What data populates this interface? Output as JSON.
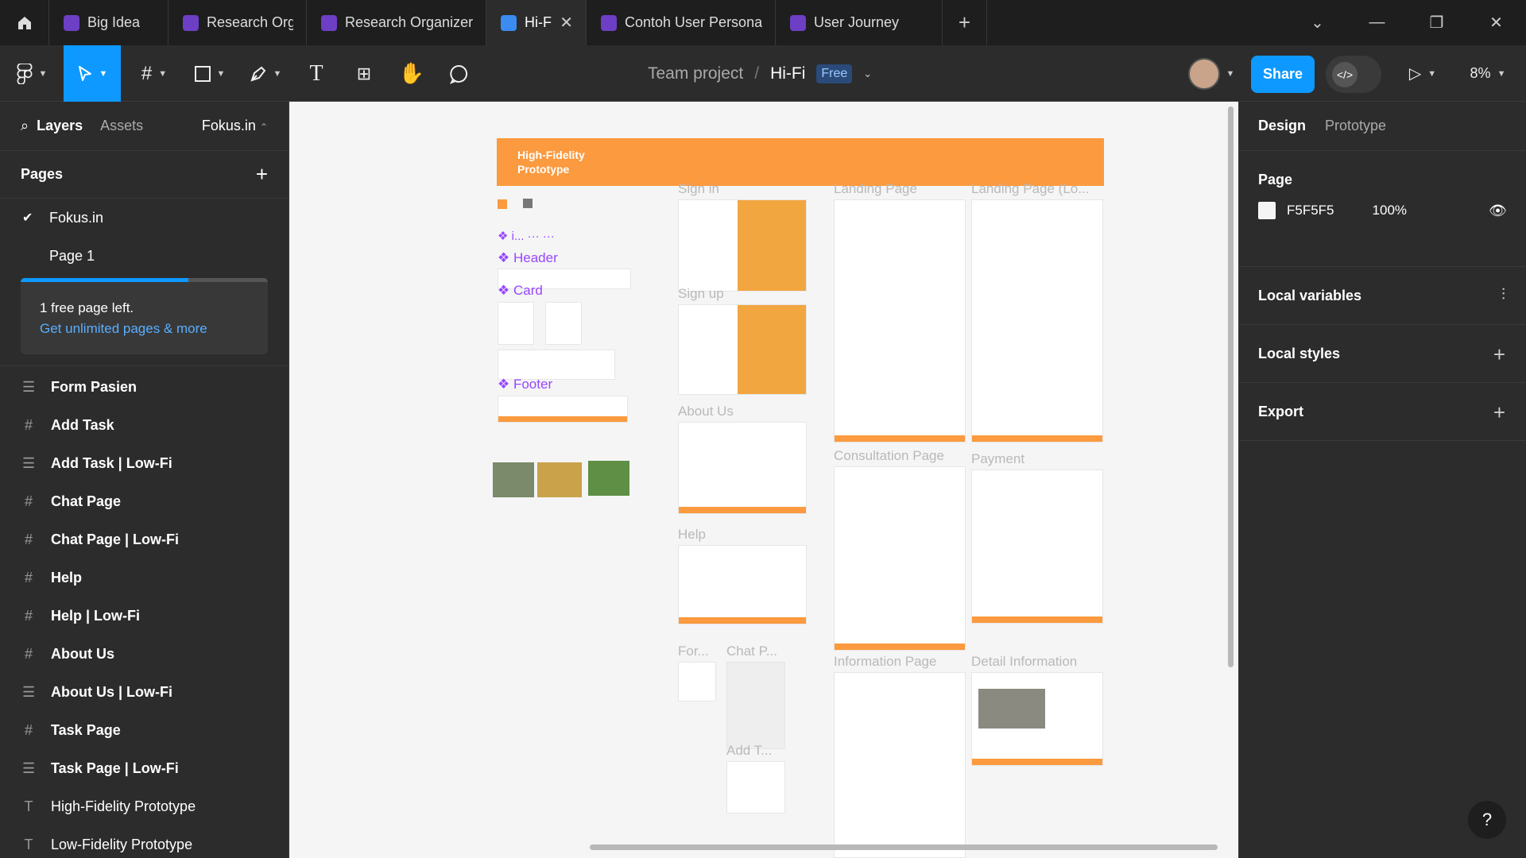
{
  "tabs": [
    {
      "label": "Big Idea"
    },
    {
      "label": "Research Organizer (C"
    },
    {
      "label": "Research Organizer (K"
    },
    {
      "label": "Hi-Fi",
      "active": true
    },
    {
      "label": "Contoh User Persona"
    },
    {
      "label": "User Journey"
    }
  ],
  "toolbar": {
    "project": "Team project",
    "separator": "/",
    "file": "Hi-Fi",
    "plan_badge": "Free",
    "share_label": "Share",
    "zoom": "8%"
  },
  "left": {
    "tab_layers": "Layers",
    "tab_assets": "Assets",
    "file_name": "Fokus.in",
    "pages_title": "Pages",
    "pages": [
      "Fokus.in",
      "Page 1"
    ],
    "promo_text": "1 free page left.",
    "promo_link": "Get unlimited pages & more",
    "layers": [
      {
        "label": "Form Pasien",
        "icon": "lines"
      },
      {
        "label": "Add Task",
        "icon": "hash"
      },
      {
        "label": "Add Task | Low-Fi",
        "icon": "lines"
      },
      {
        "label": "Chat Page",
        "icon": "hash"
      },
      {
        "label": "Chat Page | Low-Fi",
        "icon": "hash"
      },
      {
        "label": "Help",
        "icon": "hash"
      },
      {
        "label": "Help | Low-Fi",
        "icon": "hash"
      },
      {
        "label": "About Us",
        "icon": "hash"
      },
      {
        "label": "About Us | Low-Fi",
        "icon": "lines"
      },
      {
        "label": "Task Page",
        "icon": "hash"
      },
      {
        "label": "Task Page | Low-Fi",
        "icon": "lines"
      },
      {
        "label": "High-Fidelity Prototype",
        "icon": "text"
      },
      {
        "label": "Low-Fidelity Prototype",
        "icon": "text"
      }
    ]
  },
  "canvas": {
    "banner": "High-Fidelity Prototype",
    "components": {
      "header": "Header",
      "card": "Card",
      "footer": "Footer",
      "truncated": "i..."
    },
    "labels": {
      "sign_in": "Sign in",
      "sign_up": "Sign up",
      "about": "About Us",
      "help": "Help",
      "form": "For...",
      "chat": "Chat P...",
      "add": "Add T...",
      "landing": "Landing Page",
      "landing_lo": "Landing Page (Lo...",
      "consult": "Consultation Page",
      "payment": "Payment",
      "info": "Information Page",
      "detail": "Detail Information"
    }
  },
  "right": {
    "tab_design": "Design",
    "tab_prototype": "Prototype",
    "page_title": "Page",
    "page_color": "F5F5F5",
    "page_opacity": "100%",
    "local_variables": "Local variables",
    "local_styles": "Local styles",
    "export": "Export"
  },
  "colors": {
    "accent": "#0d99ff",
    "orange": "#fb9a3e",
    "canvas": "#F5F5F5",
    "component": "#9747ff"
  }
}
